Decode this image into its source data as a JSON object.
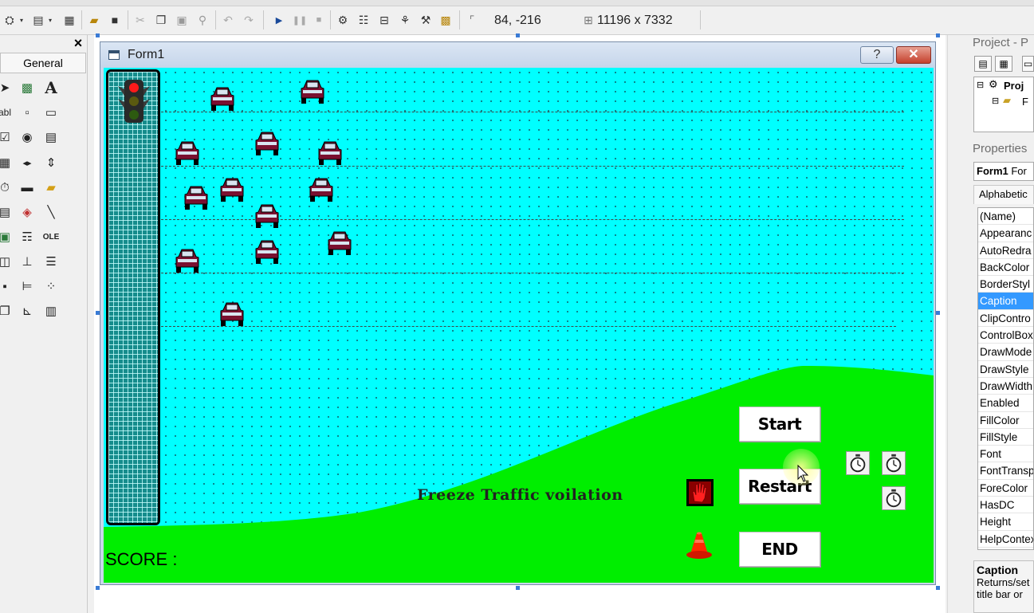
{
  "toolbar": {
    "position_readout": "84, -216",
    "size_readout": "11196 x 7332",
    "buttons": [
      "add-project-icon",
      "add-form-icon",
      "menu-editor-icon",
      "open-project-icon",
      "save-project-icon",
      "cut-icon",
      "copy-icon",
      "paste-icon",
      "find-icon",
      "undo-icon",
      "redo-icon",
      "start-icon",
      "break-icon",
      "end-icon",
      "project-explorer-icon",
      "properties-window-icon",
      "form-layout-icon",
      "object-browser-icon",
      "toolbox-icon",
      "data-view-icon"
    ]
  },
  "toolbox": {
    "close_label": "×",
    "tab_label": "General"
  },
  "form": {
    "title": "Form1",
    "help_label": "?",
    "close_label": "✕",
    "caption_text": "Freeze Traffic voilation",
    "score_label": "SCORE :",
    "start_label": "Start",
    "restart_label": "Restart",
    "end_label": "END"
  },
  "project_pane": {
    "title": "Project - P",
    "tree_root": "Proj",
    "tree_child": "F"
  },
  "properties_pane": {
    "title": "Properties",
    "object_name": "Form1",
    "object_type": "For",
    "tab_label": "Alphabetic",
    "rows": [
      "(Name)",
      "Appearanc",
      "AutoRedra",
      "BackColor",
      "BorderStyl",
      "Caption",
      "ClipContro",
      "ControlBox",
      "DrawMode",
      "DrawStyle",
      "DrawWidth",
      "Enabled",
      "FillColor",
      "FillStyle",
      "Font",
      "FontTransp",
      "ForeColor",
      "HasDC",
      "Height",
      "HelpContex"
    ],
    "selected_row": "Caption",
    "desc_title": "Caption",
    "desc_line1": "Returns/set",
    "desc_line2": "title bar or"
  },
  "colors": {
    "form_background": "#00ffff",
    "hill": "#00ee00",
    "signal_panel": "#158c8c",
    "selection": "#3399ff"
  }
}
